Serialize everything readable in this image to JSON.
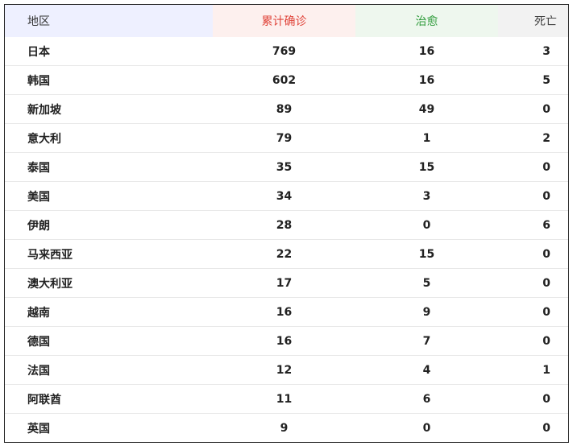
{
  "table": {
    "headers": {
      "region": "地区",
      "confirmed": "累计确诊",
      "cured": "治愈",
      "dead": "死亡"
    },
    "header_colors": {
      "region_bg": "#eef0ff",
      "confirmed_text": "#e0443a",
      "confirmed_bg": "#fdf0ee",
      "cured_text": "#2e9b3a",
      "cured_bg": "#eef7ee",
      "dead_bg": "#f2f2f2"
    },
    "rows": [
      {
        "region": "日本",
        "confirmed": "769",
        "cured": "16",
        "dead": "3"
      },
      {
        "region": "韩国",
        "confirmed": "602",
        "cured": "16",
        "dead": "5"
      },
      {
        "region": "新加坡",
        "confirmed": "89",
        "cured": "49",
        "dead": "0"
      },
      {
        "region": "意大利",
        "confirmed": "79",
        "cured": "1",
        "dead": "2"
      },
      {
        "region": "泰国",
        "confirmed": "35",
        "cured": "15",
        "dead": "0"
      },
      {
        "region": "美国",
        "confirmed": "34",
        "cured": "3",
        "dead": "0"
      },
      {
        "region": "伊朗",
        "confirmed": "28",
        "cured": "0",
        "dead": "6"
      },
      {
        "region": "马来西亚",
        "confirmed": "22",
        "cured": "15",
        "dead": "0"
      },
      {
        "region": "澳大利亚",
        "confirmed": "17",
        "cured": "5",
        "dead": "0"
      },
      {
        "region": "越南",
        "confirmed": "16",
        "cured": "9",
        "dead": "0"
      },
      {
        "region": "德国",
        "confirmed": "16",
        "cured": "7",
        "dead": "0"
      },
      {
        "region": "法国",
        "confirmed": "12",
        "cured": "4",
        "dead": "1"
      },
      {
        "region": "阿联酋",
        "confirmed": "11",
        "cured": "6",
        "dead": "0"
      },
      {
        "region": "英国",
        "confirmed": "9",
        "cured": "0",
        "dead": "0"
      }
    ]
  }
}
